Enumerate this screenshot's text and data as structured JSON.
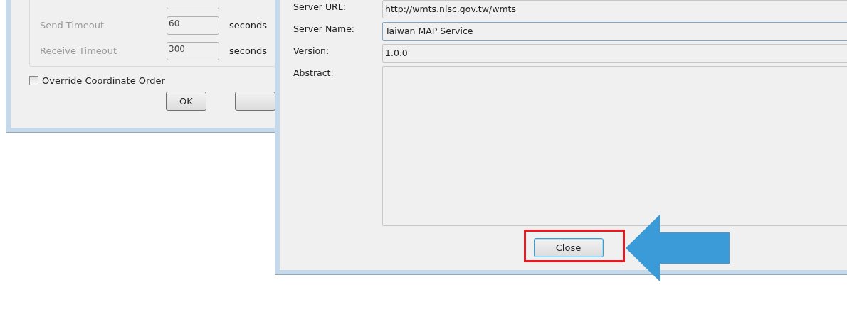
{
  "connection_dialog": {
    "timeouts": [
      {
        "label": "Send Timeout",
        "value": "60",
        "unit": "seconds",
        "disabled": true
      },
      {
        "label": "Receive Timeout",
        "value": "300",
        "unit": "seconds",
        "disabled": true
      }
    ],
    "override_coordinate_order": {
      "label": "Override Coordinate Order",
      "checked": false
    },
    "buttons": [
      "OK"
    ]
  },
  "server_info_dialog": {
    "fields": [
      {
        "label": "Server URL:",
        "value": "http://wmts.nlsc.gov.tw/wmts",
        "focused": false
      },
      {
        "label": "Server Name:",
        "value": "Taiwan MAP Service",
        "focused": true
      },
      {
        "label": "Version:",
        "value": "1.0.0",
        "focused": false
      },
      {
        "label": "Abstract:",
        "focused": false,
        "kind": "multiline"
      }
    ],
    "close_button": "Close"
  }
}
